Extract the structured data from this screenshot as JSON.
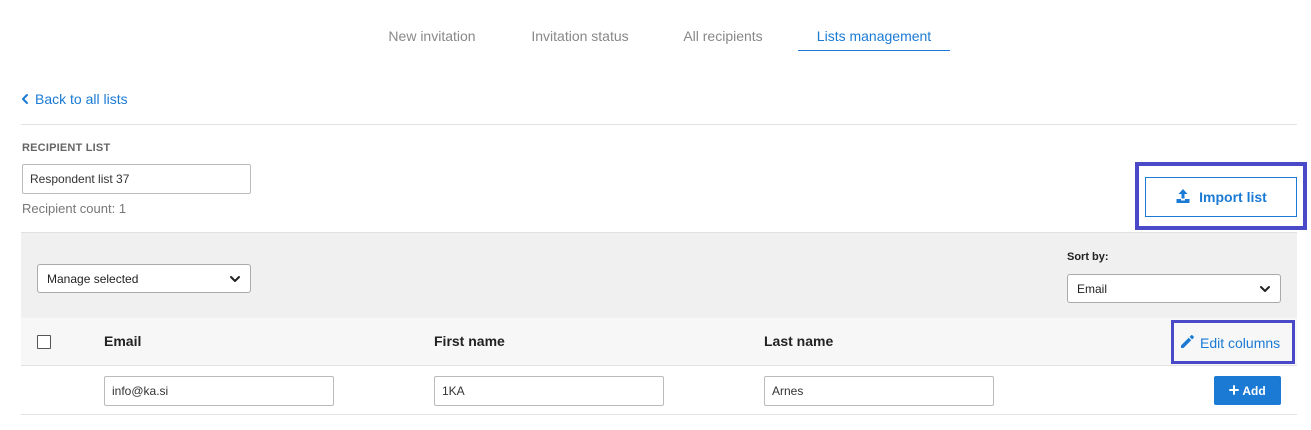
{
  "nav": {
    "tabs": [
      {
        "label": "New invitation",
        "active": false
      },
      {
        "label": "Invitation status",
        "active": false
      },
      {
        "label": "All recipients",
        "active": false
      },
      {
        "label": "Lists management",
        "active": true
      }
    ]
  },
  "back_link": {
    "label": "Back to all lists",
    "icon": "chevron-left-icon"
  },
  "recipient_list": {
    "section_label": "RECIPIENT LIST",
    "name_value": "Respondent list 37",
    "count_text": "Recipient count: 1"
  },
  "import": {
    "label": "Import list",
    "icon": "upload-icon"
  },
  "toolbar": {
    "manage_selected": "Manage selected",
    "sort_label": "Sort by:",
    "sort_value": "Email"
  },
  "table": {
    "columns": [
      "Email",
      "First name",
      "Last name"
    ],
    "edit_columns_label": "Edit columns",
    "row": {
      "email": "info@ka.si",
      "first_name": "1KA",
      "last_name": "Arnes",
      "add_label": "Add"
    }
  },
  "colors": {
    "accent": "#1a7ad4",
    "highlight": "#4a4ac8",
    "toolbar_bg": "#f0f0f0"
  }
}
